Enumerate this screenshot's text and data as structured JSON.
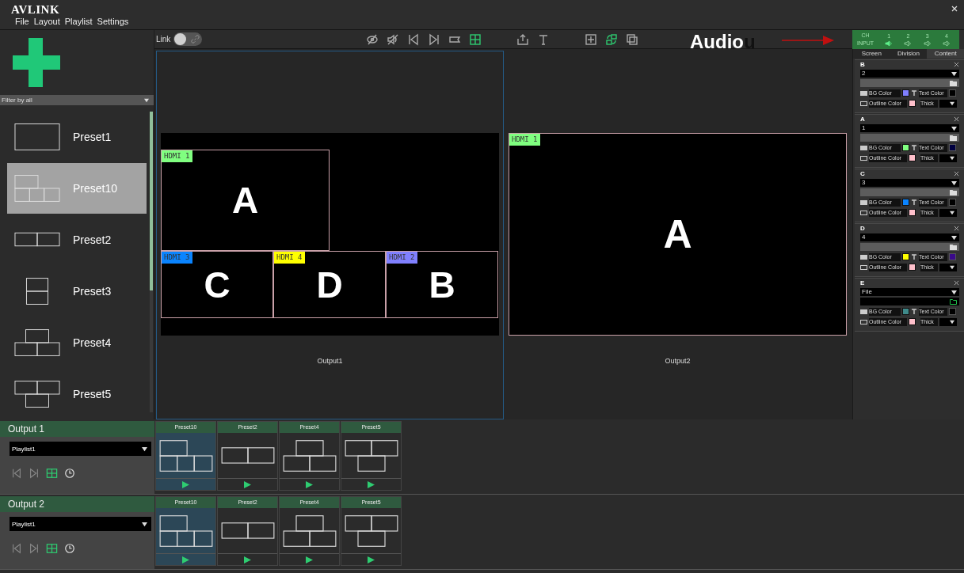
{
  "app": {
    "logo": "AVLINK"
  },
  "menu": [
    "File",
    "Layout",
    "Playlist",
    "Settings"
  ],
  "sidebar": {
    "filter": "Filter by all",
    "presets": [
      {
        "name": "Preset1",
        "kind": "single",
        "selected": false
      },
      {
        "name": "Preset10",
        "kind": "two-over-three",
        "selected": true
      },
      {
        "name": "Preset2",
        "kind": "side-by-side",
        "selected": false
      },
      {
        "name": "Preset3",
        "kind": "stacked",
        "selected": false
      },
      {
        "name": "Preset4",
        "kind": "one-over-two",
        "selected": false
      },
      {
        "name": "Preset5",
        "kind": "two-over-one",
        "selected": false
      }
    ]
  },
  "toolbar": {
    "link_label": "Link",
    "link_on": false,
    "tools": [
      {
        "kind": "hide",
        "active": false
      },
      {
        "kind": "mute",
        "active": false
      },
      {
        "kind": "prev",
        "active": false
      },
      {
        "kind": "next",
        "active": false
      },
      {
        "kind": "label",
        "active": false
      },
      {
        "kind": "grid",
        "active": true
      },
      {
        "kind": "export",
        "active": false
      },
      {
        "kind": "text",
        "active": false
      },
      {
        "kind": "fit",
        "active": false
      },
      {
        "kind": "swap",
        "active": true
      },
      {
        "kind": "copy",
        "active": false
      }
    ]
  },
  "annotation": {
    "text": "Audio",
    "tail": "u"
  },
  "outputs": [
    {
      "caption": "Output1",
      "selected": true,
      "kind": "two-over-three",
      "windows": [
        {
          "letter": "A",
          "label": "HDMI 1",
          "color": "#80ff80"
        },
        {
          "letter": "C",
          "label": "HDMI 3",
          "color": "#0a84ff"
        },
        {
          "letter": "D",
          "label": "HDMI 4",
          "color": "#ffff00"
        },
        {
          "letter": "B",
          "label": "HDMI 2",
          "color": "#8080ff"
        }
      ]
    },
    {
      "caption": "Output2",
      "selected": false,
      "kind": "single",
      "windows": [
        {
          "letter": "A",
          "label": "HDMI 1",
          "color": "#80ff80"
        }
      ]
    }
  ],
  "audio": {
    "ch_label": "CH",
    "input_label": "INPUT",
    "channels": [
      {
        "number": "1",
        "selected": true
      },
      {
        "number": "2",
        "selected": false
      },
      {
        "number": "3",
        "selected": false
      },
      {
        "number": "4",
        "selected": false
      }
    ]
  },
  "panel_tabs": [
    {
      "label": "Screen",
      "selected": false
    },
    {
      "label": "Division",
      "selected": false
    },
    {
      "label": "Content",
      "selected": true
    }
  ],
  "window_settings": [
    {
      "title": "B",
      "kind": "input",
      "source": "2",
      "swatches": [
        {
          "label": "BG Color",
          "color": "#8080ff"
        },
        {
          "label": "Text Color",
          "color": "#000000"
        },
        {
          "label": "Outline Color",
          "color": "#ffc0cb"
        }
      ],
      "thick_label": "Thick"
    },
    {
      "title": "A",
      "kind": "input",
      "source": "1",
      "swatches": [
        {
          "label": "BG Color",
          "color": "#80ff80"
        },
        {
          "label": "Text Color",
          "color": "#000040"
        },
        {
          "label": "Outline Color",
          "color": "#ffc0cb"
        }
      ],
      "thick_label": "Thick"
    },
    {
      "title": "C",
      "kind": "input",
      "source": "3",
      "swatches": [
        {
          "label": "BG Color",
          "color": "#0a84ff"
        },
        {
          "label": "Text Color",
          "color": "#000000"
        },
        {
          "label": "Outline Color",
          "color": "#ffc0cb"
        }
      ],
      "thick_label": "Thick"
    },
    {
      "title": "D",
      "kind": "input",
      "source": "4",
      "swatches": [
        {
          "label": "BG Color",
          "color": "#ffff00"
        },
        {
          "label": "Text Color",
          "color": "#3a0a8a"
        },
        {
          "label": "Outline Color",
          "color": "#ffc0cb"
        }
      ],
      "thick_label": "Thick"
    },
    {
      "title": "E",
      "kind": "file",
      "source": "File",
      "swatches": [
        {
          "label": "BG Color",
          "color": "#3f8a8a"
        },
        {
          "label": "Text Color",
          "color": "#000000"
        },
        {
          "label": "Outline Color",
          "color": "#ffc0cb"
        }
      ],
      "thick_label": "Thick"
    }
  ],
  "playlists": [
    {
      "title": "Output 1",
      "playlist": "Playlist1",
      "items": [
        {
          "name": "Preset10",
          "kind": "two-over-three",
          "selected": true
        },
        {
          "name": "Preset2",
          "kind": "side-by-side",
          "selected": false
        },
        {
          "name": "Preset4",
          "kind": "one-over-two",
          "selected": false
        },
        {
          "name": "Preset5",
          "kind": "two-over-one",
          "selected": false
        }
      ]
    },
    {
      "title": "Output 2",
      "playlist": "Playlist1",
      "items": [
        {
          "name": "Preset10",
          "kind": "two-over-three",
          "selected": true
        },
        {
          "name": "Preset2",
          "kind": "side-by-side",
          "selected": false
        },
        {
          "name": "Preset4",
          "kind": "one-over-two",
          "selected": false
        },
        {
          "name": "Preset5",
          "kind": "two-over-one",
          "selected": false
        }
      ]
    }
  ]
}
